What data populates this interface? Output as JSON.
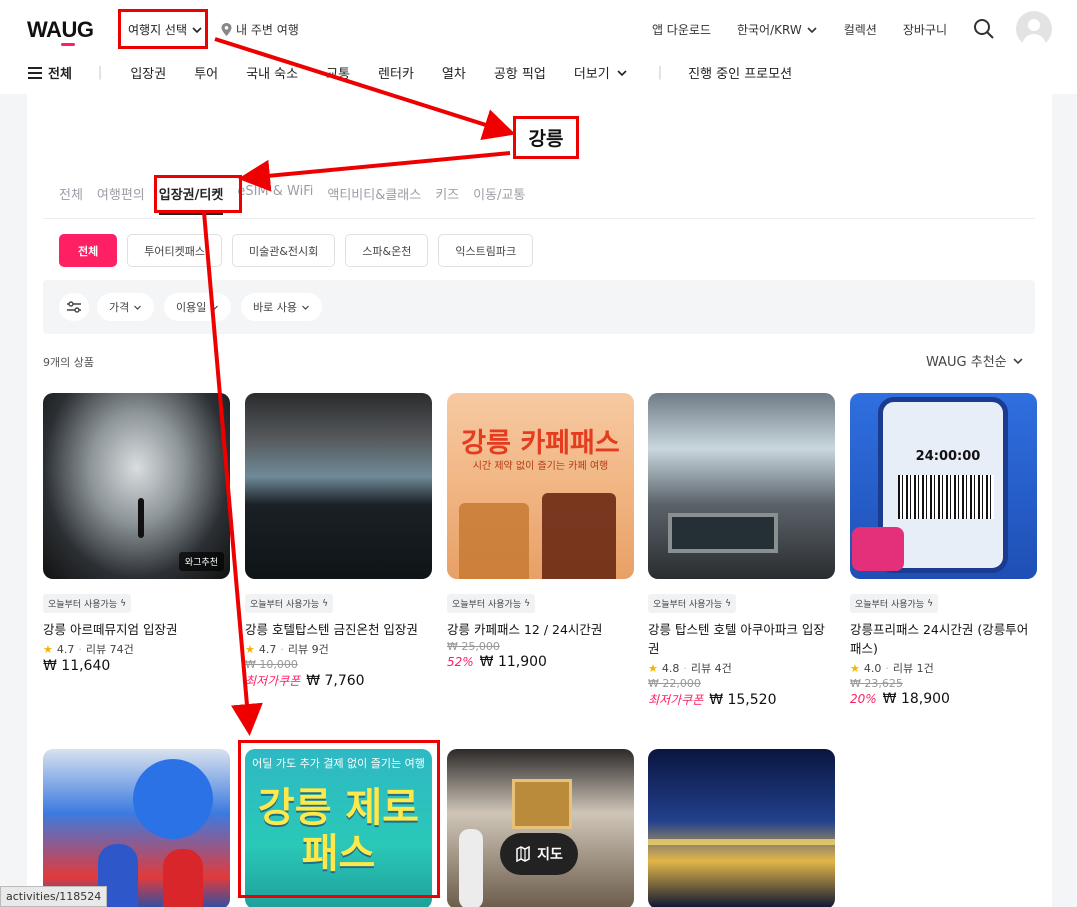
{
  "header": {
    "logo": "WAUG",
    "destination_select": "여행지 선택",
    "nearby": "내 주변 여행",
    "app_download": "앱 다운로드",
    "language_currency": "한국어/KRW",
    "collection": "컬렉션",
    "cart": "장바구니"
  },
  "nav": {
    "all": "전체",
    "items": [
      "입장권",
      "투어",
      "국내 숙소",
      "교통",
      "렌터카",
      "열차",
      "공항 픽업"
    ],
    "more": "더보기",
    "promotion": "진행 중인 프로모션"
  },
  "annotation": {
    "city_label": "강릉"
  },
  "category_tabs": [
    "전체",
    "여행편의",
    "입장권/티켓",
    "eSIM & WiFi",
    "액티비티&클래스",
    "키즈",
    "이동/교통"
  ],
  "active_tab_index": 2,
  "chips": [
    "전체",
    "투어티켓패스",
    "미술관&전시회",
    "스파&온천",
    "익스트림파크"
  ],
  "filters": {
    "price": "가격",
    "date": "이용일",
    "instant": "바로 사용"
  },
  "product_count": "9개의 상품",
  "sort": "WAUG 추천순",
  "products": [
    {
      "name": "강릉 아르떼뮤지엄 입장권",
      "availability": "오늘부터 사용가능",
      "image_badge": "와그추천",
      "rating": "4.7",
      "reviews": "리뷰 74건",
      "original_price": "",
      "discount": "",
      "price": "₩ 11,640"
    },
    {
      "name": "강릉 호텔탑스텐 금진온천 입장권",
      "availability": "오늘부터 사용가능",
      "rating": "4.7",
      "reviews": "리뷰 9건",
      "original_price": "₩ 10,000",
      "discount": "최저가쿠폰",
      "price": "₩ 7,760"
    },
    {
      "name": "강릉 카페패스 12 / 24시간권",
      "availability": "오늘부터 사용가능",
      "image_title": "강릉 카페패스",
      "image_subtitle": "시간 제약 없이 즐기는 카페 여행",
      "original_price": "₩ 25,000",
      "discount": "52%",
      "price": "₩ 11,900"
    },
    {
      "name": "강릉 탑스텐 호텔 아쿠아파크 입장권",
      "availability": "오늘부터 사용가능",
      "rating": "4.8",
      "reviews": "리뷰 4건",
      "original_price": "₩ 22,000",
      "discount": "최저가쿠폰",
      "price": "₩ 15,520"
    },
    {
      "name": "강릉프리패스 24시간권 (강릉투어패스)",
      "availability": "오늘부터 사용가능",
      "image_timer": "24:00:00",
      "rating": "4.0",
      "reviews": "리뷰 1건",
      "original_price": "₩ 23,625",
      "discount": "20%",
      "price": "₩ 18,900"
    }
  ],
  "second_row_images": [
    {
      "alt": "couple-photo"
    },
    {
      "title": "강릉 제로패스",
      "subtitle": "어딜 가도 추가 결제 없이 즐기는 여행"
    },
    {
      "alt": "museum-interior"
    },
    {
      "alt": "starry-night-exhibit"
    }
  ],
  "map_button": "지도",
  "status_url": "activities/118524",
  "colors": {
    "accent": "#ff2063",
    "annotation": "#ee0000"
  }
}
